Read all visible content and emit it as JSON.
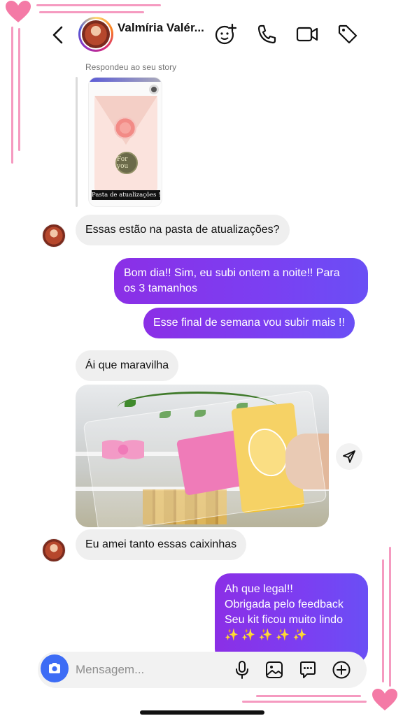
{
  "header": {
    "contact_name": "Valmíria Valér...",
    "icons": [
      "back-arrow-icon",
      "add-people-icon",
      "phone-icon",
      "video-camera-icon",
      "tag-icon"
    ]
  },
  "story_reply": {
    "label": "Respondeu ao seu story",
    "card_caption": "Pasta de atualizações !!",
    "seal_text": "For you"
  },
  "messages": [
    {
      "side": "in",
      "lines": [
        "Essas estão na pasta de atualizações?"
      ]
    },
    {
      "side": "out",
      "lines": [
        "Bom dia!! Sim, eu subi ontem a noite!! Para",
        "os 3 tamanhos"
      ]
    },
    {
      "side": "out",
      "lines": [
        "Esse final de semana vou subir mais !!"
      ]
    },
    {
      "side": "in",
      "lines": [
        "Ái que maravilha"
      ]
    },
    {
      "side": "in",
      "type": "photo"
    },
    {
      "side": "in",
      "lines": [
        "Eu amei tanto essas caixinhas"
      ]
    },
    {
      "side": "out",
      "lines": [
        "Ah que legal!!",
        "Obrigada pelo feedback",
        "Seu kit ficou muito lindo",
        "✨ ✨ ✨ ✨ ✨"
      ]
    }
  ],
  "composer": {
    "placeholder": "Mensagem...",
    "icons": [
      "camera-icon",
      "microphone-icon",
      "gallery-icon",
      "sticker-chat-icon",
      "plus-circle-icon"
    ]
  },
  "colors": {
    "outgoing_start": "#8b2fe6",
    "outgoing_end": "#6a4ff5",
    "incoming": "#efefef",
    "camera_button": "#3d6cf5",
    "decoration_pink": "#f59ac0"
  }
}
